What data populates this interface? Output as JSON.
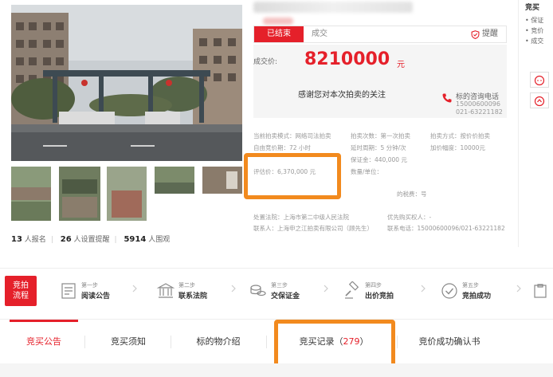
{
  "status": {
    "tag": "已结束",
    "text": "成交",
    "remind_label": "提醒"
  },
  "price": {
    "label": "成交价:",
    "value": "8210000",
    "unit": "元"
  },
  "thanks": {
    "text": "感谢您对本次拍卖的关注",
    "consult_label": "标的咨询电话",
    "phone_1": "15000600096",
    "phone_2": "021-63221182"
  },
  "details": {
    "mode": "当前拍卖模式：网络司法拍卖",
    "period": "自由竞价期：72 小时",
    "round": "拍卖次数：第一次拍卖",
    "delay": "延时周期：5 分钟/次",
    "deposit": "保证金：440,000 元",
    "method": "拍卖方式：按价价拍卖",
    "increment": "加价幅度：10000元",
    "appraisal": "评估价：6,370,000 元",
    "quantity": "数量/单位：",
    "reserve": "的税费：号",
    "court": "处置法院：上海市第二中级人民法院",
    "contact": "联系人：上海申之江拍卖有限公司（顾先生）",
    "priority": "优先购买权人：-",
    "contact_phone": "联系电话：15000600096/021-63221182"
  },
  "stats": {
    "signup_count": "13",
    "signup_label": "人报名",
    "remind_count": "26",
    "remind_label": "人设置提醒",
    "view_count": "5914",
    "view_label": "人围观"
  },
  "right_col": {
    "title": "竞买",
    "items": [
      "• 保证",
      "• 竞价",
      "• 成交"
    ]
  },
  "process": {
    "badge_line1": "竞拍",
    "badge_line2": "流程",
    "steps": [
      {
        "no": "第一步",
        "name": "阅读公告",
        "icon": "document-icon"
      },
      {
        "no": "第二步",
        "name": "联系法院",
        "icon": "court-icon"
      },
      {
        "no": "第三步",
        "name": "交保证金",
        "icon": "coins-icon"
      },
      {
        "no": "第四步",
        "name": "出价竞拍",
        "icon": "gavel-icon"
      },
      {
        "no": "第五步",
        "name": "竞拍成功",
        "icon": "check-circle-icon"
      }
    ]
  },
  "tabs": [
    {
      "label": "竞买公告",
      "active": true
    },
    {
      "label": "竞买须知",
      "active": false
    },
    {
      "label": "标的物介绍",
      "active": false
    },
    {
      "label": "竞买记录（",
      "count": "279",
      "suffix": "）",
      "active": false
    },
    {
      "label": "竞价成功确认书",
      "active": false
    }
  ],
  "colors": {
    "accent": "#e5202a",
    "highlight": "#f28a1e"
  }
}
